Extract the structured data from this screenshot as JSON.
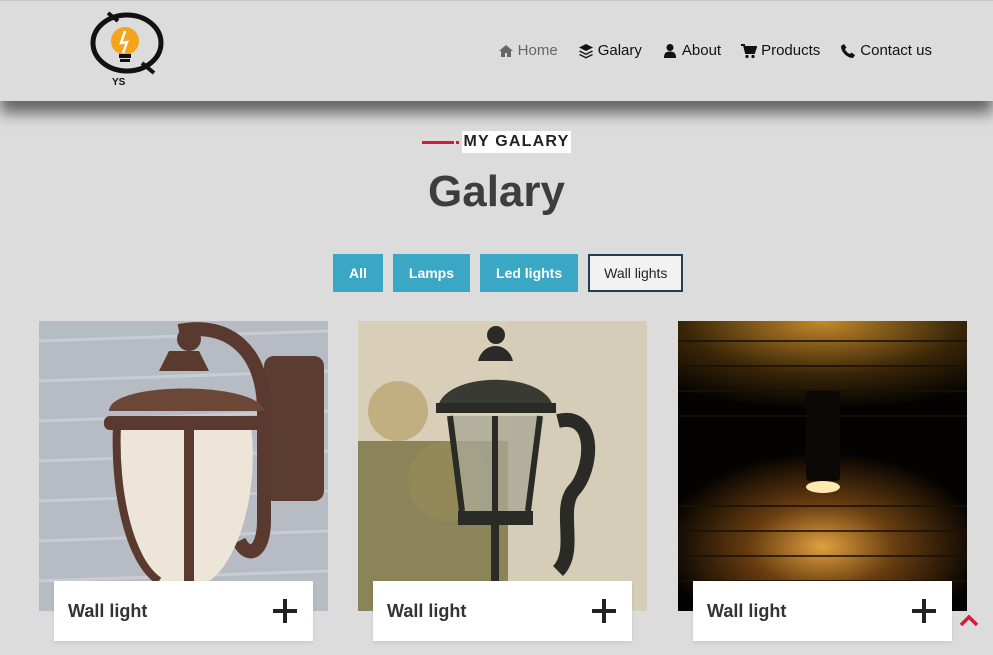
{
  "header": {
    "logo_text": "YS",
    "nav": [
      {
        "label": "Home",
        "icon": "home-icon"
      },
      {
        "label": "Galary",
        "icon": "layers-icon"
      },
      {
        "label": "About",
        "icon": "user-icon"
      },
      {
        "label": "Products",
        "icon": "cart-icon"
      },
      {
        "label": "Contact us",
        "icon": "phone-icon"
      }
    ]
  },
  "section": {
    "subtitle": "MY GALARY",
    "title": "Galary",
    "accent_color": "#d31b3a"
  },
  "filters": [
    {
      "label": "All"
    },
    {
      "label": "Lamps"
    },
    {
      "label": "Led lights"
    },
    {
      "label": "Wall lights"
    }
  ],
  "active_filter": "Wall lights",
  "colors": {
    "filter_bg": "#3aa8c4",
    "active_border": "#1f3f57",
    "scroll_top": "#d31b3a"
  },
  "cards": [
    {
      "label": "Wall light"
    },
    {
      "label": "Wall light"
    },
    {
      "label": "Wall light"
    }
  ]
}
